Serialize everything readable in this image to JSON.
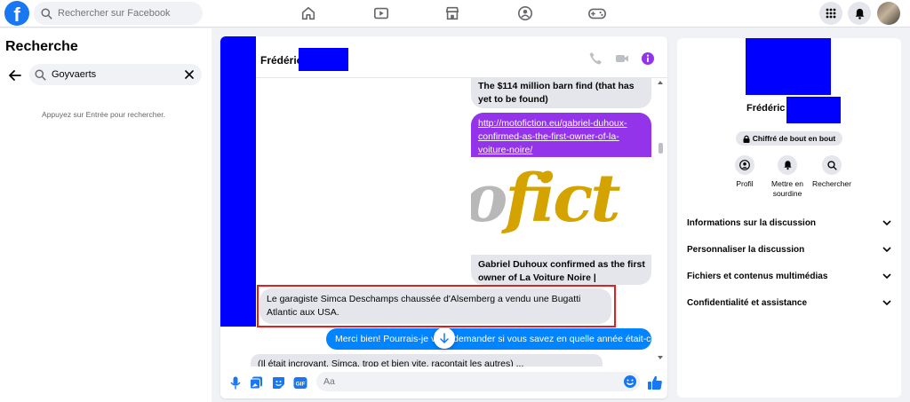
{
  "topbar": {
    "logo_text": "f",
    "search_placeholder": "Rechercher sur Facebook",
    "nav_icons": [
      "home-icon",
      "watch-icon",
      "marketplace-icon",
      "groups-icon",
      "gaming-icon"
    ],
    "right_icons": [
      "menu-grid-icon",
      "notifications-icon",
      "account-avatar"
    ]
  },
  "left": {
    "title": "Recherche",
    "search_value": "Goyvaerts",
    "hint": "Appuyez sur Entrée pour rechercher."
  },
  "chat": {
    "contact_name": "Frédéric",
    "header_icons": [
      "phone-icon",
      "video-icon",
      "info-icon"
    ],
    "messages": {
      "top_partial": "The $114 million barn find (that has yet to be found)",
      "link_url": "http://motofiction.eu/gabriel-duhoux-confirmed-as-the-first-owner-of-la-voiture-noire/",
      "link_image_text_a": "o",
      "link_image_text_b": "fict",
      "link_caption": "Gabriel Duhoux confirmed as the first owner of La Voiture Noire | Motofiction",
      "highlighted": "Le garagiste Simca Deschamps chaussée d'Alsemberg a vendu une Bugatti Atlantic aux USA.",
      "sent": "Merci bien! Pourrais-je vous demander si vous savez en quelle année était-ce?",
      "partial_bottom": "(Il était incroyant, Simca, trop et bien vite, racontait les autres) ..."
    },
    "composer_placeholder": "Aa",
    "composer_icons": [
      "microphone-icon",
      "image-icon",
      "sticker-icon",
      "gif-icon",
      "emoji-icon",
      "thumbs-up-icon"
    ]
  },
  "right": {
    "name": "Frédéric",
    "encryption_badge": "Chiffré de bout en bout",
    "actions": [
      {
        "label": "Profil",
        "icon": "profile-icon"
      },
      {
        "label": "Mettre en sourdine",
        "icon": "bell-icon"
      },
      {
        "label": "Rechercher",
        "icon": "search-icon"
      }
    ],
    "sections": [
      "Informations sur la discussion",
      "Personnaliser la discussion",
      "Fichiers et contenus multimédias",
      "Confidentialité et assistance"
    ]
  },
  "colors": {
    "brand": "#1877f2",
    "sent_bubble": "#0084ff",
    "link_preview": "#9333ea",
    "redaction": "#0000ff",
    "highlight_border": "#e02020"
  }
}
